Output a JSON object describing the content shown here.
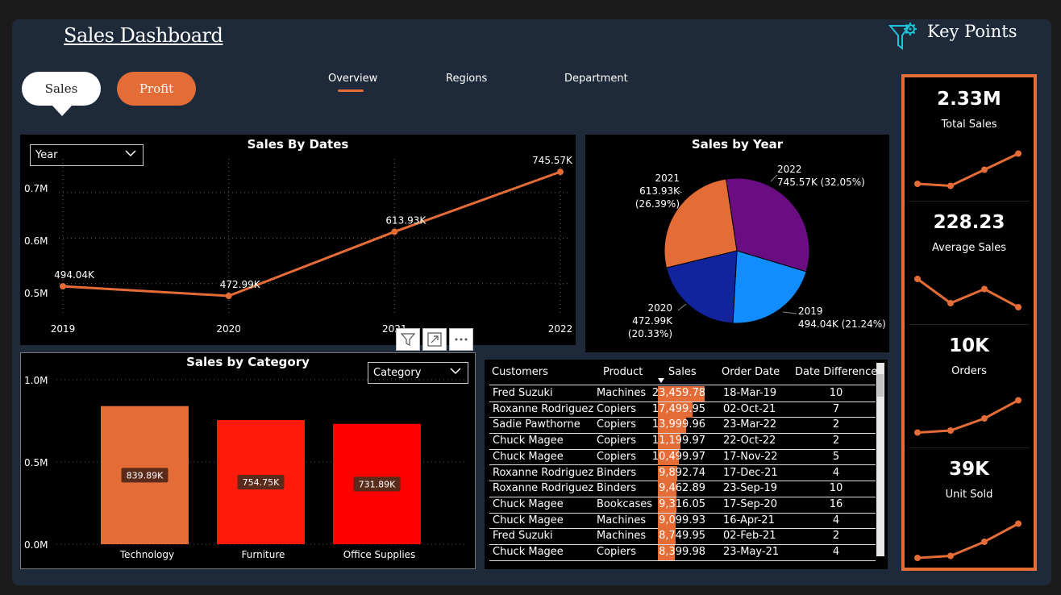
{
  "header": {
    "title": "Sales Dashboard",
    "key_points": "Key Points"
  },
  "buttons": {
    "sales": "Sales",
    "profit": "Profit"
  },
  "tabs": [
    "Overview",
    "Regions",
    "Department"
  ],
  "line_chart": {
    "title": "Sales By Dates",
    "dropdown": "Year",
    "y_ticks": [
      "0.7M",
      "0.6M",
      "0.5M"
    ]
  },
  "pie_chart": {
    "title": "Sales by Year",
    "labels": [
      {
        "year": "2022",
        "value": "745.57K (32.05%)"
      },
      {
        "year": "2021",
        "value": "613.93K (26.39%)"
      },
      {
        "year": "2020",
        "value": "472.99K (20.33%)"
      },
      {
        "year": "2019",
        "value": "494.04K (21.24%)"
      }
    ]
  },
  "bar_chart": {
    "title": "Sales by Category",
    "dropdown": "Category",
    "y_ticks": [
      "1.0M",
      "0.5M",
      "0.0M"
    ]
  },
  "chart_data": [
    {
      "type": "line",
      "title": "Sales By Dates",
      "x": [
        "2019",
        "2020",
        "2021",
        "2022"
      ],
      "series": [
        {
          "values": [
            494040,
            472990,
            613930,
            745570
          ],
          "labels": [
            "494.04K",
            "472.99K",
            "613.93K",
            "745.57K"
          ]
        }
      ],
      "ylim": [
        450000,
        760000
      ],
      "grid": true,
      "color": "#e46c37"
    },
    {
      "type": "pie",
      "title": "Sales by Year",
      "categories": [
        "2022",
        "2019",
        "2020",
        "2021"
      ],
      "values": [
        745570,
        494040,
        472990,
        613930
      ],
      "colors": [
        "#6a0d83",
        "#118dff",
        "#12239e",
        "#e46c37"
      ]
    },
    {
      "type": "bar",
      "title": "Sales by Category",
      "categories": [
        "Technology",
        "Furniture",
        "Office Supplies"
      ],
      "values": [
        839890,
        754750,
        731890
      ],
      "labels": [
        "839.89K",
        "754.75K",
        "731.89K"
      ],
      "colors": [
        "#e46c37",
        "#ff1a0c",
        "#ff0000"
      ],
      "ylim": [
        0,
        1000000
      ]
    }
  ],
  "table": {
    "columns": [
      "Customers",
      "Product",
      "Sales",
      "Order Date",
      "Date Difference"
    ],
    "rows": [
      [
        "Fred Suzuki",
        "Machines",
        "23,459.78",
        "18-Mar-19",
        "10"
      ],
      [
        "Roxanne Rodriguez",
        "Copiers",
        "17,499.95",
        "02-Oct-21",
        "7"
      ],
      [
        "Sadie Pawthorne",
        "Copiers",
        "13,999.96",
        "23-Mar-22",
        "2"
      ],
      [
        "Chuck Magee",
        "Copiers",
        "11,199.97",
        "22-Oct-22",
        "2"
      ],
      [
        "Chuck Magee",
        "Copiers",
        "10,499.97",
        "17-Nov-22",
        "5"
      ],
      [
        "Roxanne Rodriguez",
        "Binders",
        "9,892.74",
        "17-Dec-21",
        "4"
      ],
      [
        "Roxanne Rodriguez",
        "Binders",
        "9,462.89",
        "23-Sep-19",
        "10"
      ],
      [
        "Chuck Magee",
        "Bookcases",
        "9,316.05",
        "17-Sep-20",
        "16"
      ],
      [
        "Chuck Magee",
        "Machines",
        "9,099.93",
        "16-Apr-21",
        "4"
      ],
      [
        "Fred Suzuki",
        "Machines",
        "8,749.95",
        "02-Feb-21",
        "2"
      ],
      [
        "Chuck Magee",
        "Copiers",
        "8,399.98",
        "23-May-21",
        "4"
      ]
    ],
    "sales_values": [
      23459.78,
      17499.95,
      13999.96,
      11199.97,
      10499.97,
      9892.74,
      9462.89,
      9316.05,
      9099.93,
      8749.95,
      8399.98
    ]
  },
  "kpis": [
    {
      "value": "2.33M",
      "label": "Total Sales",
      "trend": [
        0.2,
        0.15,
        0.55,
        0.95
      ]
    },
    {
      "value": "228.23",
      "label": "Average Sales",
      "trend": [
        0.9,
        0.3,
        0.65,
        0.2
      ]
    },
    {
      "value": "10K",
      "label": "Orders",
      "trend": [
        0.15,
        0.2,
        0.5,
        0.95
      ]
    },
    {
      "value": "39K",
      "label": "Unit Sold",
      "trend": [
        0.1,
        0.15,
        0.5,
        0.95
      ]
    }
  ],
  "icons": [
    "filter-gear-icon",
    "filter-icon",
    "focus-mode-icon",
    "more-options-icon",
    "chevron-down-icon",
    "sort-down-icon"
  ]
}
